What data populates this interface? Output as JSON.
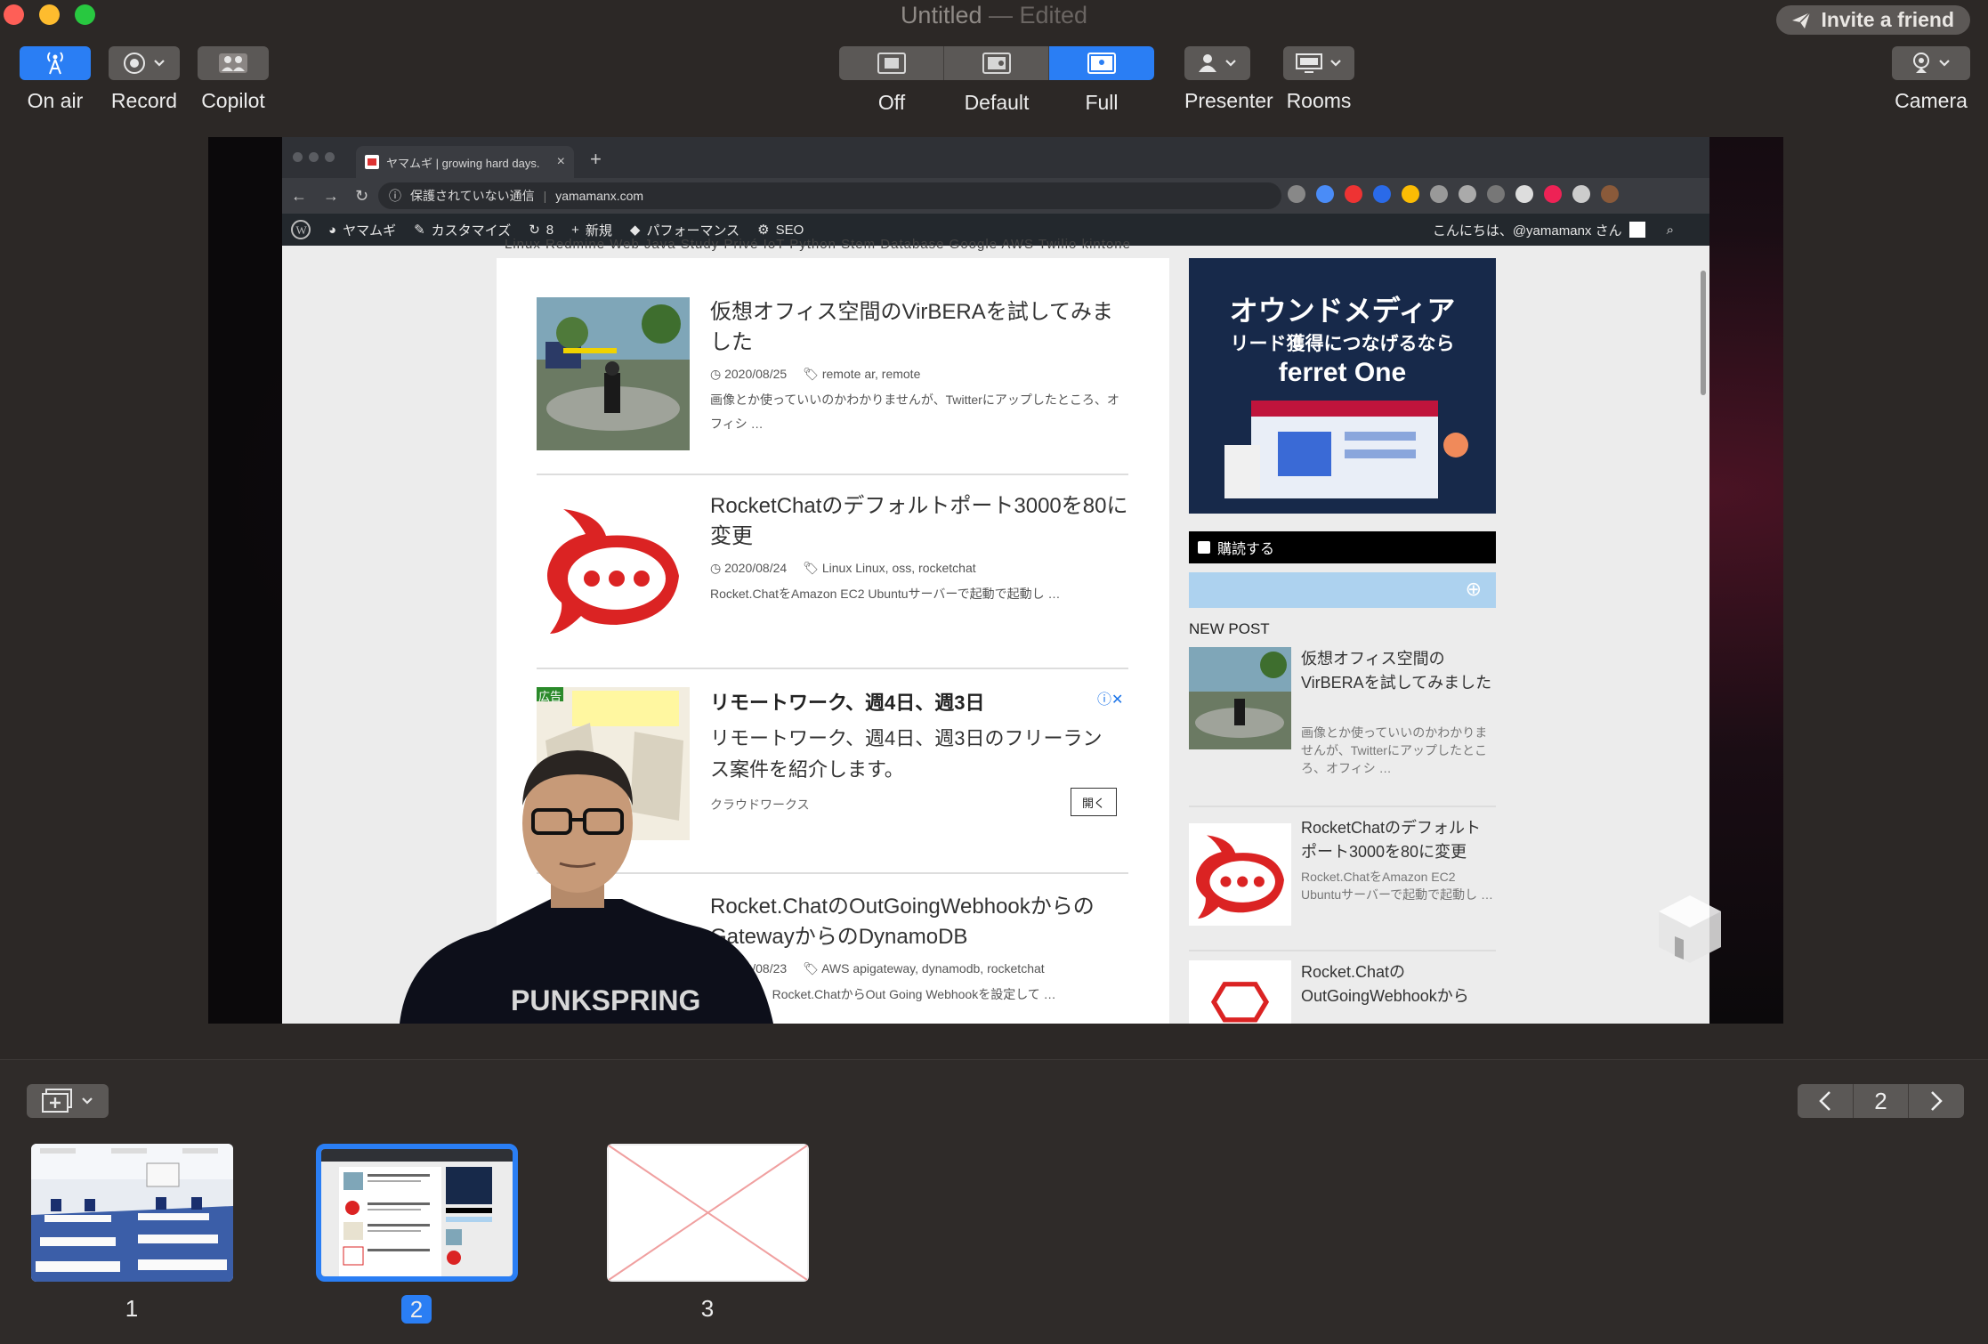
{
  "window": {
    "title": "Untitled",
    "title_suffix": "— Edited",
    "invite_label": "Invite a friend"
  },
  "toolbar": {
    "on_air": "On air",
    "record": "Record",
    "copilot": "Copilot",
    "layout_options": [
      "Off",
      "Default",
      "Full"
    ],
    "selected_layout": "Full",
    "presenter": "Presenter",
    "rooms": "Rooms",
    "camera": "Camera"
  },
  "browser": {
    "tab_title": "ヤマムギ | growing hard days.",
    "security_label": "保護されていない通信",
    "url": "yamamanx.com",
    "wp_bar": {
      "site": "ヤマムギ",
      "customize": "カスタマイズ",
      "updates": "8",
      "new": "新規",
      "performance": "パフォーマンス",
      "seo": "SEO",
      "greeting": "こんにちは、@yamamanx さん"
    },
    "cut_nav": "Linux    Redmine    Web    Java    Study    Privé    IoT    Python    Stem    Database    Google    AWS    Twilio    kintone"
  },
  "posts": [
    {
      "title": "仮想オフィス空間のVirBERAを試してみました",
      "date": "2020/08/25",
      "tags": "remote ar, remote",
      "excerpt": "画像とか使っていいのかわかりませんが、Twitterにアップしたところ、オフィシ …"
    },
    {
      "title": "RocketChatのデフォルトポート3000を80に変更",
      "date": "2020/08/24",
      "tags": "Linux Linux, oss, rocketchat",
      "excerpt": "Rocket.ChatをAmazon EC2 Ubuntuサーバーで起動で起動し …"
    },
    {
      "title": "Rocket.ChatのOutGoingWebhookからのGatewayからのDynamoDB",
      "date": "2020/08/23",
      "tags": "AWS apigateway, dynamodb, rocketchat",
      "excerpt": "少し前に、Rocket.ChatからOut Going Webhookを設定して …"
    }
  ],
  "ad": {
    "badge": "広告",
    "title": "リモートワーク、週4日、週3日",
    "description": "リモートワーク、週4日、週3日のフリーランス案件を紹介します。",
    "source": "クラウドワークス",
    "open_label": "開く"
  },
  "sidebar": {
    "banner_line1": "オウンドメディア",
    "banner_line2": "リード獲得につなげるなら",
    "banner_line3": "ferret One",
    "subscribe": "購読する",
    "new_post_heading": "NEW POST",
    "posts": [
      {
        "title": "仮想オフィス空間のVirBERAを試してみました",
        "excerpt": "画像とか使っていいのかわかりませんが、Twitterにアップしたところ、オフィシ …"
      },
      {
        "title": "RocketChatのデフォルトポート3000を80に変更",
        "excerpt": "Rocket.ChatをAmazon EC2 Ubuntuサーバーで起動で起動し …"
      },
      {
        "title": "Rocket.ChatのOutGoingWebhookから",
        "excerpt": ""
      }
    ]
  },
  "pager": {
    "current": "2"
  },
  "slides": [
    {
      "number": "1",
      "selected": false
    },
    {
      "number": "2",
      "selected": true
    },
    {
      "number": "3",
      "selected": false
    }
  ],
  "colors": {
    "accent": "#2a7ef4",
    "background": "#2c2826",
    "button": "#5b5856"
  }
}
